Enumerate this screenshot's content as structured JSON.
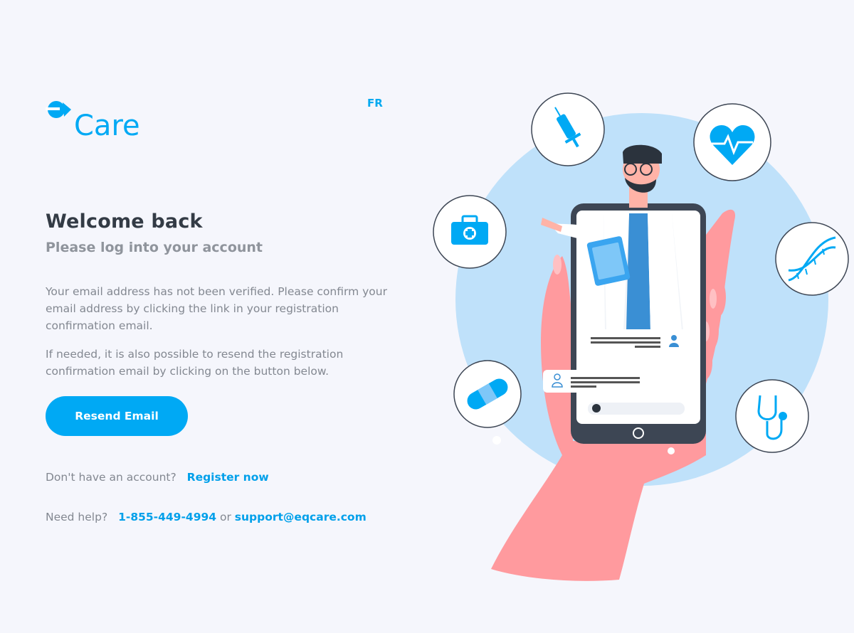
{
  "brand": {
    "logo_mark": "eq",
    "logo_text": "Care"
  },
  "lang_toggle": "FR",
  "welcome_title": "Welcome back",
  "welcome_subtitle": "Please log into your account",
  "message": {
    "line1": "Your email address has not been verified. Please confirm your email address by clicking the link in your registration confirmation email.",
    "line2": "If needed, it is also possible to resend the registration confirmation email by clicking on the button below."
  },
  "resend_button": "Resend Email",
  "register": {
    "prompt": "Don't have an account?",
    "link": "Register now"
  },
  "help": {
    "prompt": "Need help?",
    "phone": "1-855-449-4994",
    "or": "or",
    "email": "support@eqcare.com"
  },
  "illustration_icons": [
    "syringe-icon",
    "heart-pulse-icon",
    "first-aid-kit-icon",
    "dna-icon",
    "bandage-icon",
    "stethoscope-icon"
  ],
  "colors": {
    "accent": "#00a9f4",
    "background": "#f5f6fc",
    "heading": "#333b45",
    "muted": "#838891",
    "illustration_circle": "#bfe1fa",
    "hand": "#ff9a9e"
  }
}
